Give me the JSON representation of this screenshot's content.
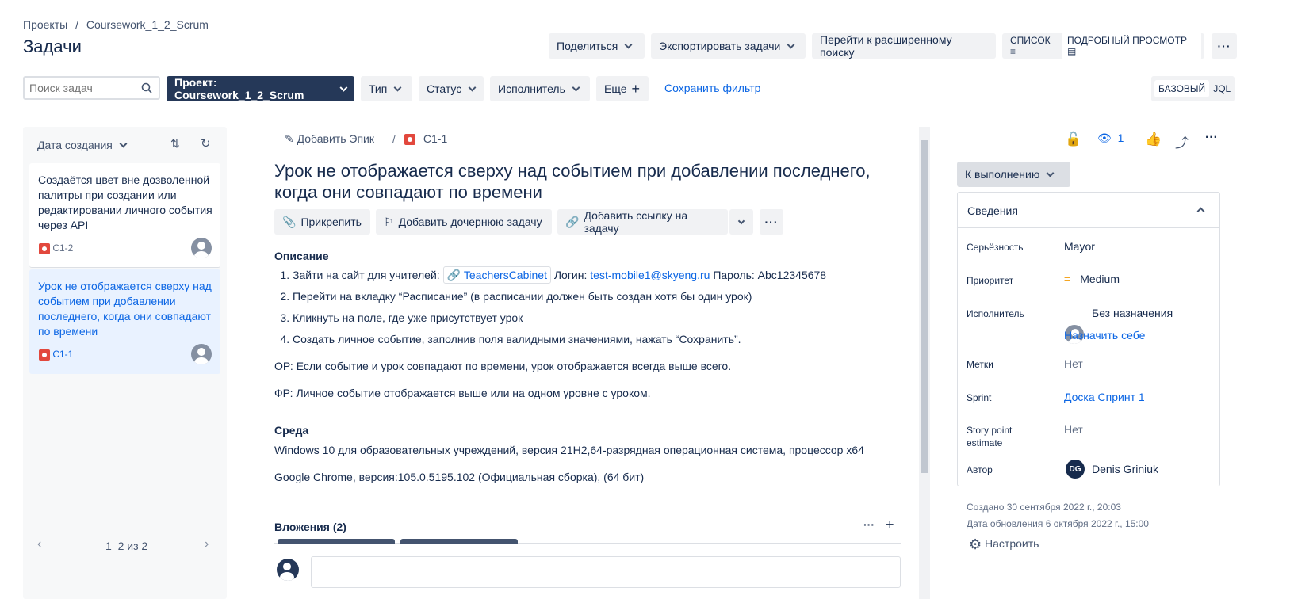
{
  "breadcrumb": {
    "root": "Проекты",
    "sep": "/",
    "project": "Coursework_1_2_Scrum"
  },
  "page_title": "Задачи",
  "top_actions": {
    "share": "Поделиться",
    "export": "Экспортировать задачи",
    "advanced_search": "Перейти к расширенному поиску",
    "list_view": "СПИСОК",
    "detail_view": "ПОДРОБНЫЙ ПРОСМОТР"
  },
  "filters": {
    "search_placeholder": "Поиск задач",
    "project": "Проект: Coursework_1_2_Scrum",
    "type": "Тип",
    "status": "Статус",
    "assignee": "Исполнитель",
    "more": "Еще",
    "save_filter": "Сохранить фильтр",
    "basic": "БАЗОВЫЙ",
    "jql": "JQL"
  },
  "list": {
    "sort_label": "Дата создания",
    "items": [
      {
        "title": "Создаётся цвет вне дозволенной палитры при создании или редактировании личного события через API",
        "key": "C1-2"
      },
      {
        "title": "Урок не отображается сверху над событием при добавлении последнего, когда они совпадают по времени",
        "key": "C1-1"
      }
    ],
    "pagination": "1–2 из 2"
  },
  "issue": {
    "add_epic": "Добавить Эпик",
    "sep": "/",
    "key": "C1-1",
    "title": "Урок не отображается сверху над событием при добавлении последнего, когда они совпадают по времени",
    "actions": {
      "attach": "Прикрепить",
      "child": "Добавить дочернюю задачу",
      "link": "Добавить ссылку на задачу"
    },
    "description_heading": "Описание",
    "step1_prefix": "Зайти на сайт для учителей:",
    "step1_link": "TeachersCabinet",
    "step1_login_label": "Логин:",
    "step1_login": "test-mobile1@skyeng.ru",
    "step1_pass": "Пароль: Abc12345678",
    "step2": "Перейти на вкладку “Расписание” (в расписании должен быть создан хотя бы один урок)",
    "step3": "Кликнуть на поле, где уже присутствует урок",
    "step4": "Создать личное событие, заполнив поля валидными значениями, нажать “Сохранить”.",
    "expected": "ОР: Если событие и урок совпадают по времени, урок отображается всегда выше всего.",
    "actual": "ФР: Личное событие отображается выше или на одном уровне с уроком.",
    "env_heading": "Среда",
    "env1": "Windows 10 для образовательных учреждений, версия 21H2,64-разрядная операционная система, процессор x64",
    "env2": "Google Chrome, версия:105.0.5195.102 (Официальная сборка), (64 бит)",
    "attachments": "Вложения (2)"
  },
  "side": {
    "watchers": "1",
    "status": "К выполнению",
    "details": "Сведения",
    "fields": {
      "severity_label": "Серьёзность",
      "severity": "Mayor",
      "priority_label": "Приоритет",
      "priority": "Medium",
      "assignee_label": "Исполнитель",
      "assignee": "Без назначения",
      "assign_me": "Назначить себе",
      "labels_label": "Метки",
      "labels": "Нет",
      "sprint_label": "Sprint",
      "sprint": "Доска Спринт 1",
      "sp_label": "Story point estimate",
      "sp": "Нет",
      "author_label": "Автор",
      "author_initials": "DG",
      "author": "Denis Griniuk"
    },
    "created": "Создано 30 сентября 2022 г., 20:03",
    "updated": "Дата обновления 6 октября 2022 г., 15:00",
    "configure": "Настроить"
  },
  "colors": {
    "accent": "#0c66e4",
    "dark": "#253858",
    "selected": "#e9f2ff",
    "bug": "#e2483d",
    "priority": "#f5a623"
  }
}
